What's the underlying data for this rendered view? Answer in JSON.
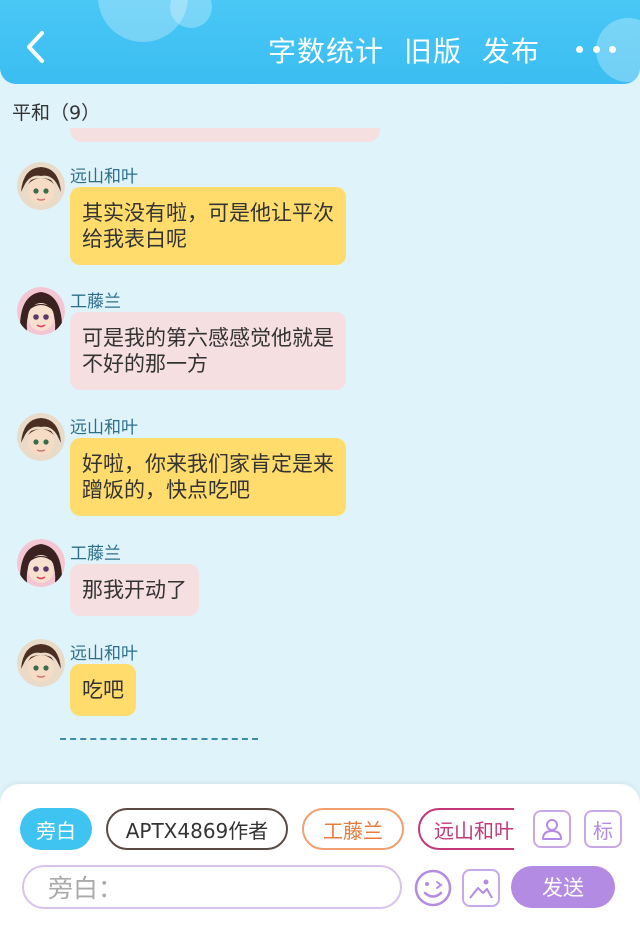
{
  "header": {
    "actions": [
      "字数统计",
      "旧版",
      "发布"
    ]
  },
  "section": {
    "label": "平和（9）"
  },
  "messages": [
    {
      "sender": "远山和叶",
      "text": "其实没有啦，可是他让平次\n给我表白呢",
      "style": "yellow",
      "avatar": "heiji-avatar"
    },
    {
      "sender": "工藤兰",
      "text": "可是我的第六感感觉他就是\n不好的那一方",
      "style": "pink",
      "avatar": "ran-avatar"
    },
    {
      "sender": "远山和叶",
      "text": "好啦，你来我们家肯定是来\n蹭饭的，快点吃吧",
      "style": "yellow",
      "avatar": "heiji-avatar"
    },
    {
      "sender": "工藤兰",
      "text": "那我开动了",
      "style": "pink",
      "avatar": "ran-avatar"
    },
    {
      "sender": "远山和叶",
      "text": "吃吧",
      "style": "yellow",
      "avatar": "heiji-avatar"
    }
  ],
  "roles": [
    {
      "label": "旁白",
      "style": "active"
    },
    {
      "label": "APTX4869作者",
      "style": "outline-dark"
    },
    {
      "label": "工藤兰",
      "style": "outline-orange"
    },
    {
      "label": "远山和叶",
      "style": "outline-magenta"
    }
  ],
  "input": {
    "placeholder": "旁白："
  },
  "send": {
    "label": "发送"
  },
  "icons": {
    "back": "chevron-left-icon",
    "more": "more-icon",
    "character": "character-icon",
    "tag": "标",
    "emoji": "emoji-icon",
    "image": "image-icon"
  },
  "colors": {
    "header": "#3bbdf2",
    "background": "#dff3fb",
    "bubble_yellow": "#ffdc6b",
    "bubble_pink": "#f5dfe0",
    "send_button": "#b48be3",
    "active_chip": "#3fc4f1"
  }
}
